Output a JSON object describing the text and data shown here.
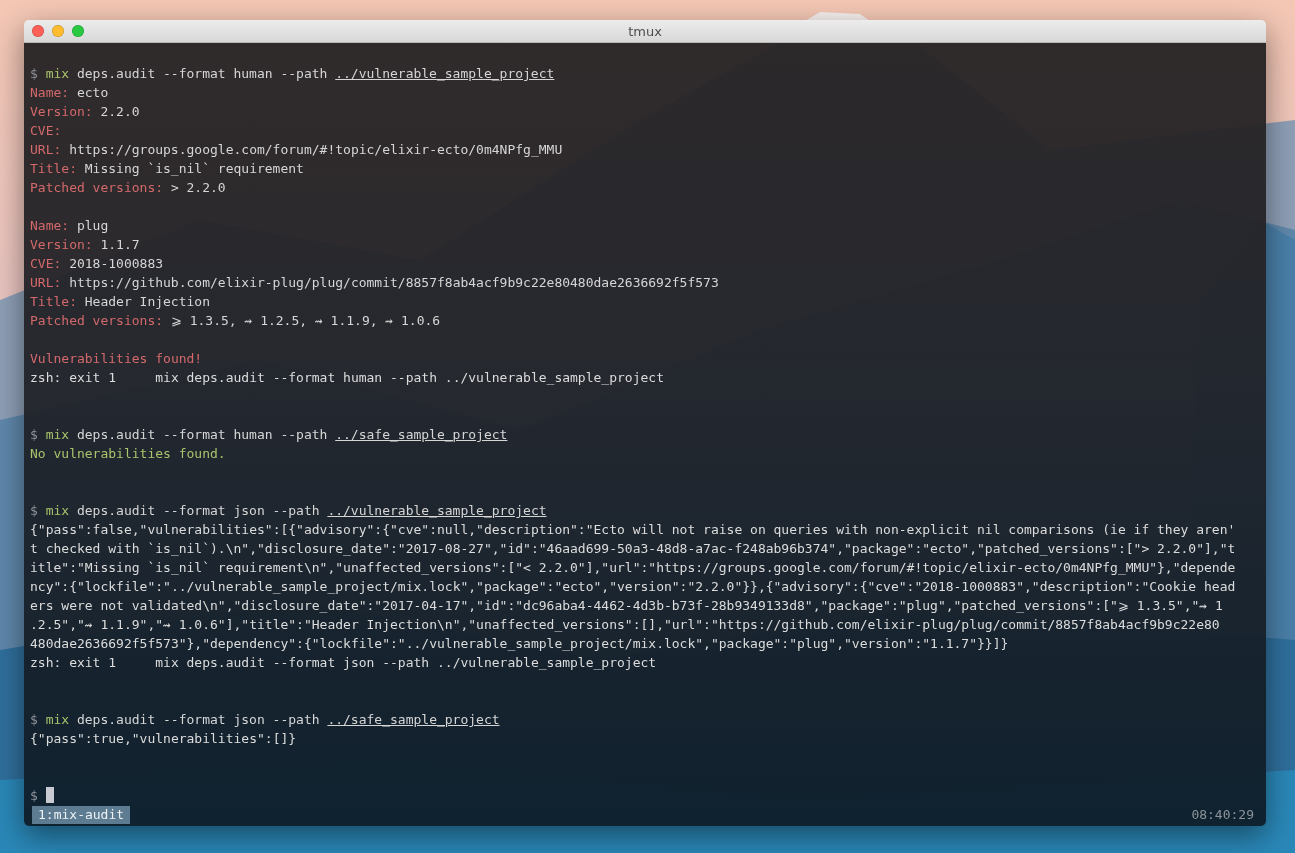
{
  "window": {
    "title": "tmux"
  },
  "lines": [
    {
      "kind": "blank"
    },
    {
      "kind": "command",
      "prompt": "$",
      "program": "mix",
      "args": "deps.audit --format human --path",
      "path": "../vulnerable_sample_project"
    },
    {
      "kind": "field",
      "label": "Name:",
      "value": "ecto"
    },
    {
      "kind": "field",
      "label": "Version:",
      "value": "2.2.0"
    },
    {
      "kind": "field",
      "label": "CVE:"
    },
    {
      "kind": "field",
      "label": "URL:",
      "value": "https://groups.google.com/forum/#!topic/elixir-ecto/0m4NPfg_MMU"
    },
    {
      "kind": "field",
      "label": "Title:",
      "value": "Missing `is_nil` requirement"
    },
    {
      "kind": "field",
      "label": "Patched versions:",
      "value": "> 2.2.0"
    },
    {
      "kind": "blank"
    },
    {
      "kind": "field",
      "label": "Name:",
      "value": "plug"
    },
    {
      "kind": "field",
      "label": "Version:",
      "value": "1.1.7"
    },
    {
      "kind": "field",
      "label": "CVE:",
      "value": "2018-1000883"
    },
    {
      "kind": "field",
      "label": "URL:",
      "value": "https://github.com/elixir-plug/plug/commit/8857f8ab4acf9b9c22e80480dae2636692f5f573"
    },
    {
      "kind": "field",
      "label": "Title:",
      "value": "Header Injection"
    },
    {
      "kind": "field",
      "label": "Patched versions:",
      "value": "⩾ 1.3.5, ⇝ 1.2.5, ⇝ 1.1.9, ⇝ 1.0.6"
    },
    {
      "kind": "blank"
    },
    {
      "kind": "error",
      "text": "Vulnerabilities found!"
    },
    {
      "kind": "plain",
      "text": "zsh: exit 1     mix deps.audit --format human --path ../vulnerable_sample_project"
    },
    {
      "kind": "blank"
    },
    {
      "kind": "blank"
    },
    {
      "kind": "command",
      "prompt": "$",
      "program": "mix",
      "args": "deps.audit --format human --path",
      "path": "../safe_sample_project"
    },
    {
      "kind": "success",
      "text": "No vulnerabilities found."
    },
    {
      "kind": "blank"
    },
    {
      "kind": "blank"
    },
    {
      "kind": "command",
      "prompt": "$",
      "program": "mix",
      "args": "deps.audit --format json --path",
      "path": "../vulnerable_sample_project"
    },
    {
      "kind": "plain",
      "text": "{\"pass\":false,\"vulnerabilities\":[{\"advisory\":{\"cve\":null,\"description\":\"Ecto will not raise on queries with non-explicit nil comparisons (ie if they aren'"
    },
    {
      "kind": "plain",
      "text": "t checked with `is_nil`).\\n\",\"disclosure_date\":\"2017-08-27\",\"id\":\"46aad699-50a3-48d8-a7ac-f248ab96b374\",\"package\":\"ecto\",\"patched_versions\":[\"> 2.2.0\"],\"t"
    },
    {
      "kind": "plain",
      "text": "itle\":\"Missing `is_nil` requirement\\n\",\"unaffected_versions\":[\"< 2.2.0\"],\"url\":\"https://groups.google.com/forum/#!topic/elixir-ecto/0m4NPfg_MMU\"},\"depende"
    },
    {
      "kind": "plain",
      "text": "ncy\":{\"lockfile\":\"../vulnerable_sample_project/mix.lock\",\"package\":\"ecto\",\"version\":\"2.2.0\"}},{\"advisory\":{\"cve\":\"2018-1000883\",\"description\":\"Cookie head"
    },
    {
      "kind": "plain",
      "text": "ers were not validated\\n\",\"disclosure_date\":\"2017-04-17\",\"id\":\"dc96aba4-4462-4d3b-b73f-28b9349133d8\",\"package\":\"plug\",\"patched_versions\":[\"⩾ 1.3.5\",\"⇝ 1"
    },
    {
      "kind": "plain",
      "text": ".2.5\",\"⇝ 1.1.9\",\"⇝ 1.0.6\"],\"title\":\"Header Injection\\n\",\"unaffected_versions\":[],\"url\":\"https://github.com/elixir-plug/plug/commit/8857f8ab4acf9b9c22e80"
    },
    {
      "kind": "plain",
      "text": "480dae2636692f5f573\"},\"dependency\":{\"lockfile\":\"../vulnerable_sample_project/mix.lock\",\"package\":\"plug\",\"version\":\"1.1.7\"}}]}"
    },
    {
      "kind": "plain",
      "text": "zsh: exit 1     mix deps.audit --format json --path ../vulnerable_sample_project"
    },
    {
      "kind": "blank"
    },
    {
      "kind": "blank"
    },
    {
      "kind": "command",
      "prompt": "$",
      "program": "mix",
      "args": "deps.audit --format json --path",
      "path": "../safe_sample_project"
    },
    {
      "kind": "plain",
      "text": "{\"pass\":true,\"vulnerabilities\":[]}"
    },
    {
      "kind": "blank"
    },
    {
      "kind": "blank"
    },
    {
      "kind": "prompt",
      "prompt": "$"
    }
  ],
  "status_bar": {
    "window_tab": "1:mix-audit",
    "time": "08:40:29"
  }
}
